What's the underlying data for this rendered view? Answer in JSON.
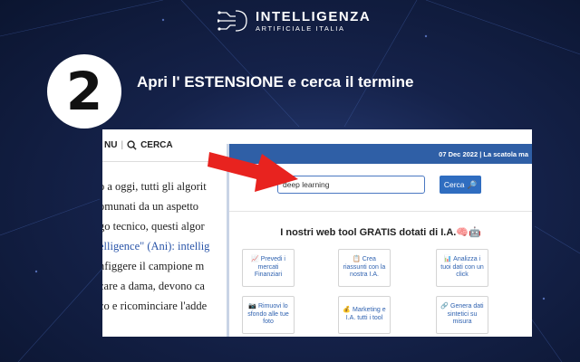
{
  "logo": {
    "title": "INTELLIGENZA",
    "subtitle": "ARTIFICIALE ITALIA",
    "icon": "circuit-brain-icon"
  },
  "step": {
    "number": "2",
    "instruction": "Apri l' ESTENSIONE e cerca il termine"
  },
  "article": {
    "nav_menu": "NU",
    "nav_search": "CERCA",
    "lines": [
      "o a oggi, tutti gli algorit",
      "omunati da un aspetto",
      "go tecnico, questi algor",
      "elligence\" (Ani): intellig",
      "nfiggere il campione m",
      "care a dama, devono ca",
      "co e ricominciare l'adde"
    ]
  },
  "extension": {
    "date_bar": "07 Dec 2022 | La scatola ma",
    "search_value": "deep learning",
    "search_button": "Cerca",
    "section_title": "I nostri web tool GRATIS dotati di I.A.🧠🤖",
    "tools": [
      {
        "icon": "📈",
        "label": "Prevedi i mercati Finanziari"
      },
      {
        "icon": "📋",
        "label": "Crea riassunti con la nostra I.A."
      },
      {
        "icon": "📊",
        "label": "Analizza i tuoi dati con un click"
      },
      {
        "icon": "📷",
        "label": "Rimuovi lo sfondo alle tue foto"
      },
      {
        "icon": "💰",
        "label": "Marketing e I.A. tutti i tool"
      },
      {
        "icon": "🔗",
        "label": "Genera dati sintetici su misura"
      }
    ]
  },
  "colors": {
    "background": "#0f1a38",
    "accent": "#2f5fa6",
    "arrow": "#e8231f"
  }
}
